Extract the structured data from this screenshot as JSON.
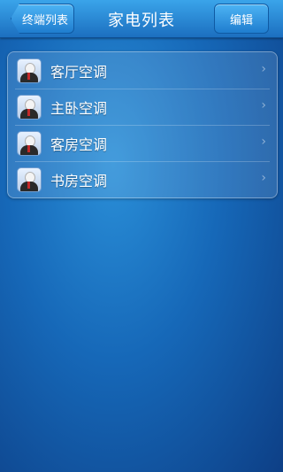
{
  "header": {
    "title": "家电列表",
    "back_label": "终端列表",
    "edit_label": "编辑"
  },
  "appliances": [
    {
      "label": "客厅空调"
    },
    {
      "label": "主卧空调"
    },
    {
      "label": "客房空调"
    },
    {
      "label": "书房空调"
    }
  ],
  "icons": {
    "avatar": "user-avatar-icon",
    "chevron": "chevron-right-icon"
  }
}
